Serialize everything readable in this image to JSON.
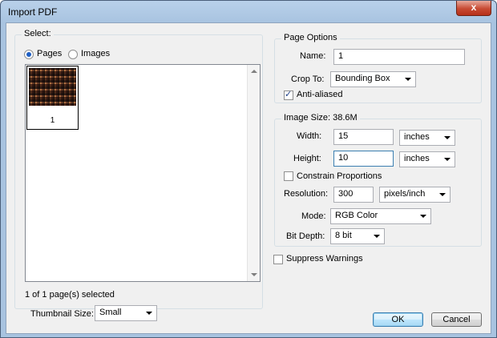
{
  "window": {
    "title": "Import PDF",
    "close_glyph": "x"
  },
  "select_group": {
    "legend": "Select:",
    "radio_pages": "Pages",
    "radio_images": "Images",
    "selected_mode": "Pages",
    "thumbnail_page_number": "1",
    "selection_status": "1 of 1 page(s) selected",
    "thumbnail_size_label": "Thumbnail Size:",
    "thumbnail_size_value": "Small"
  },
  "page_options": {
    "legend": "Page Options",
    "name_label": "Name:",
    "name_value": "1",
    "crop_label": "Crop To:",
    "crop_value": "Bounding Box",
    "anti_aliased_label": "Anti-aliased",
    "anti_aliased_checked": true
  },
  "image_size": {
    "legend": "Image Size: 38.6M",
    "width_label": "Width:",
    "width_value": "15",
    "width_unit": "inches",
    "height_label": "Height:",
    "height_value": "10",
    "height_unit": "inches",
    "constrain_label": "Constrain Proportions",
    "constrain_checked": false,
    "resolution_label": "Resolution:",
    "resolution_value": "300",
    "resolution_unit": "pixels/inch",
    "mode_label": "Mode:",
    "mode_value": "RGB Color",
    "bit_depth_label": "Bit Depth:",
    "bit_depth_value": "8 bit"
  },
  "suppress_warnings": {
    "label": "Suppress Warnings",
    "checked": false
  },
  "buttons": {
    "ok": "OK",
    "cancel": "Cancel"
  }
}
